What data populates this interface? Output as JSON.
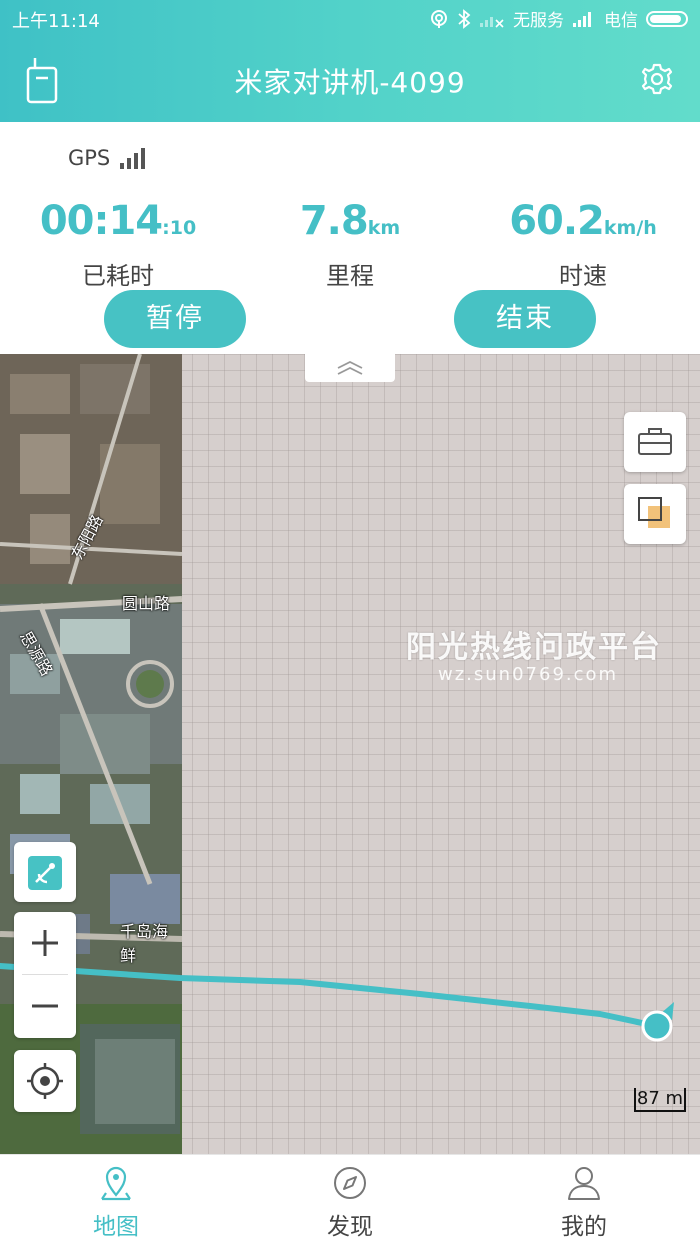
{
  "status_bar": {
    "time": "上午11:14",
    "carrier1": "无服务",
    "carrier2": "电信",
    "battery_level": 0.9
  },
  "header": {
    "title": "米家对讲机-4099",
    "left_icon": "walkie-talkie-icon",
    "right_icon": "gear-icon"
  },
  "gps": {
    "label": "GPS",
    "signal_bars": 4
  },
  "stats": [
    {
      "main": "00:14",
      "sub": ":10",
      "label": "已耗时"
    },
    {
      "main": "7.8",
      "sub": "km",
      "label": "里程"
    },
    {
      "main": "60.2",
      "sub": "km/h",
      "label": "时速"
    }
  ],
  "buttons": {
    "pause": "暂停",
    "end": "结束"
  },
  "map": {
    "roads": [
      "东阳路",
      "圆山路",
      "思源路",
      "千岛海鲜"
    ],
    "watermark": "阳光热线问政平台",
    "watermark_url": "wz.sun0769.com",
    "scale": "87 m",
    "route_color": "#45bfc6"
  },
  "nav": [
    {
      "label": "地图",
      "icon": "map-pin-icon",
      "active": true
    },
    {
      "label": "发现",
      "icon": "compass-icon",
      "active": false
    },
    {
      "label": "我的",
      "icon": "user-icon",
      "active": false
    }
  ],
  "colors": {
    "accent": "#45bfc6",
    "header_start": "#3fc1c6",
    "header_end": "#62dccb"
  }
}
